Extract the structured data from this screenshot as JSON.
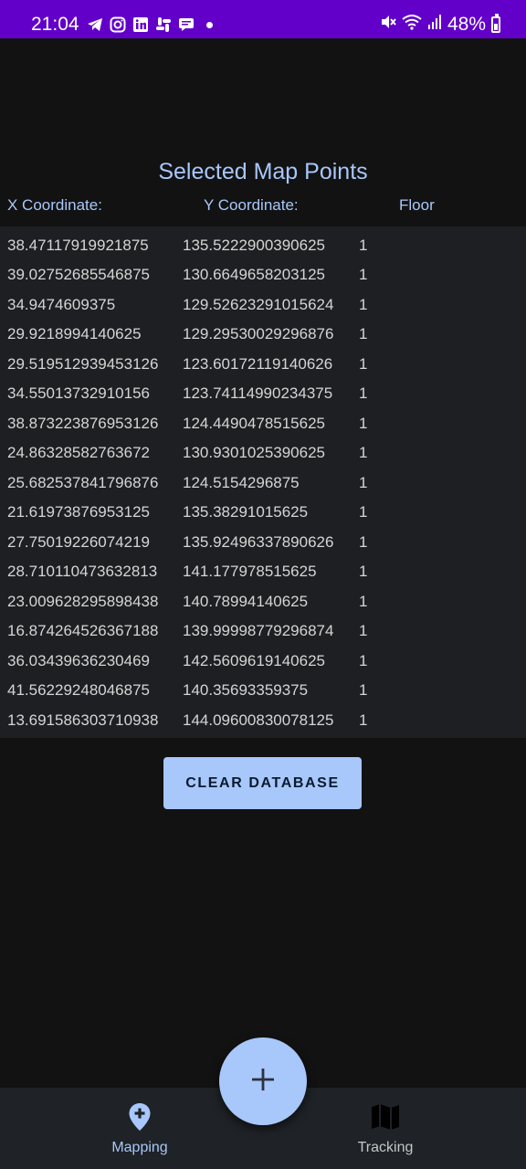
{
  "status_bar": {
    "time": "21:04",
    "battery": "48%",
    "left_icons": [
      "telegram-icon",
      "instagram-icon",
      "linkedin-icon",
      "slack-icon",
      "chat-icon"
    ],
    "right_icons": [
      "mute-icon",
      "wifi-icon",
      "signal-icon",
      "battery-icon"
    ],
    "background_color": "#6200c9"
  },
  "page": {
    "title": "Selected Map Points",
    "accent_color": "#a8c7fa"
  },
  "table": {
    "columns": [
      "X Coordinate:",
      "Y Coordinate:",
      "Floor"
    ],
    "rows": [
      [
        "38.47117919921875",
        "135.5222900390625",
        "1"
      ],
      [
        "39.02752685546875",
        "130.6649658203125",
        "1"
      ],
      [
        "34.9474609375",
        "129.52623291015624",
        "1"
      ],
      [
        "29.9218994140625",
        "129.29530029296876",
        "1"
      ],
      [
        "29.519512939453126",
        "123.60172119140626",
        "1"
      ],
      [
        "34.55013732910156",
        "123.74114990234375",
        "1"
      ],
      [
        "38.873223876953126",
        "124.4490478515625",
        "1"
      ],
      [
        "24.86328582763672",
        "130.9301025390625",
        "1"
      ],
      [
        "25.682537841796876",
        "124.5154296875",
        "1"
      ],
      [
        "21.61973876953125",
        "135.38291015625",
        "1"
      ],
      [
        "27.75019226074219",
        "135.92496337890626",
        "1"
      ],
      [
        "28.710110473632813",
        "141.177978515625",
        "1"
      ],
      [
        "23.009628295898438",
        "140.78994140625",
        "1"
      ],
      [
        "16.874264526367188",
        "139.99998779296874",
        "1"
      ],
      [
        "36.03439636230469",
        "142.5609619140625",
        "1"
      ],
      [
        "41.56229248046875",
        "140.35693359375",
        "1"
      ],
      [
        "13.691586303710938",
        "144.09600830078125",
        "1"
      ]
    ]
  },
  "actions": {
    "clear_label": "CLEAR DATABASE"
  },
  "fab": {
    "icon": "plus-icon"
  },
  "bottom_nav": {
    "items": [
      {
        "label": "Mapping",
        "icon": "map-pin-plus-icon",
        "active": true
      },
      {
        "label": "Tracking",
        "icon": "map-icon",
        "active": false
      }
    ]
  }
}
